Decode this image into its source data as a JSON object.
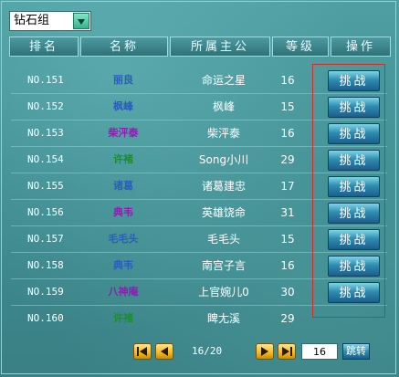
{
  "dropdown": {
    "value": "钻石组"
  },
  "header": {
    "rank": "排名",
    "name": "名称",
    "lord": "所属主公",
    "level": "等级",
    "action": "操作"
  },
  "rows": [
    {
      "rank": "NO.151",
      "name": "丽良",
      "lord": "命运之星",
      "level": "16",
      "action": "挑战",
      "name_color": "#2a5cc2"
    },
    {
      "rank": "NO.152",
      "name": "枫峰",
      "lord": "枫峰",
      "level": "15",
      "action": "挑战",
      "name_color": "#2a5cc2"
    },
    {
      "rank": "NO.153",
      "name": "柴泙泰",
      "lord": "柴泙泰",
      "level": "16",
      "action": "挑战",
      "name_color": "#8a1fb0"
    },
    {
      "rank": "NO.154",
      "name": "许褚",
      "lord": "Song小川",
      "level": "29",
      "action": "挑战",
      "name_color": "#1e8a3a"
    },
    {
      "rank": "NO.155",
      "name": "诸葛",
      "lord": "诸葛建忠",
      "level": "17",
      "action": "挑战",
      "name_color": "#2a5cc2"
    },
    {
      "rank": "NO.156",
      "name": "典韦",
      "lord": "英雄饶命",
      "level": "31",
      "action": "挑战",
      "name_color": "#8a1fb0"
    },
    {
      "rank": "NO.157",
      "name": "毛毛头",
      "lord": "毛毛头",
      "level": "15",
      "action": "挑战",
      "name_color": "#2a5cc2"
    },
    {
      "rank": "NO.158",
      "name": "典韦",
      "lord": "南宫子言",
      "level": "16",
      "action": "挑战",
      "name_color": "#2a5cc2"
    },
    {
      "rank": "NO.159",
      "name": "八神庵",
      "lord": "上官婉儿0",
      "level": "30",
      "action": "挑战",
      "name_color": "#8a1fb0"
    },
    {
      "rank": "NO.160",
      "name": "许褚",
      "lord": "睥尢溪",
      "level": "29",
      "action": "",
      "name_color": "#1e8a3a"
    }
  ],
  "pager": {
    "info": "16/20",
    "page_value": "16",
    "jump_label": "跳转"
  },
  "colors": {
    "panel": "#3e8b90",
    "header": "#2f7277",
    "button": "#2f8cb0",
    "highlight": "#d42a2a",
    "nav_button": "#f2b91f"
  }
}
